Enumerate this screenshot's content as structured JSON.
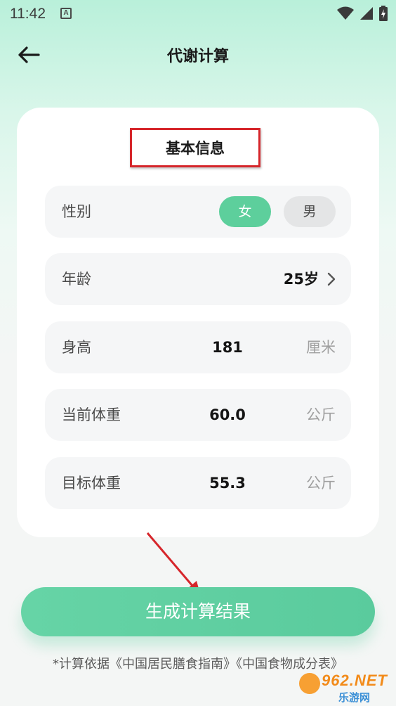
{
  "status_bar": {
    "time": "11:42",
    "app_icon_letter": "A"
  },
  "nav": {
    "title": "代谢计算"
  },
  "card": {
    "section_title": "基本信息",
    "gender": {
      "label": "性别",
      "options": [
        "女",
        "男"
      ],
      "selected": "女"
    },
    "age": {
      "label": "年龄",
      "value": "25岁"
    },
    "height": {
      "label": "身高",
      "value": "181",
      "unit": "厘米"
    },
    "current_weight": {
      "label": "当前体重",
      "value": "60.0",
      "unit": "公斤"
    },
    "target_weight": {
      "label": "目标体重",
      "value": "55.3",
      "unit": "公斤"
    }
  },
  "generate_button": {
    "label": "生成计算结果"
  },
  "footnote": "*计算依据《中国居民膳食指南》《中国食物成分表》",
  "watermark": {
    "top": "962.NET",
    "bottom": "乐游网"
  },
  "colors": {
    "accent": "#5dcf9c",
    "annotation": "#d6262b"
  },
  "icons": [
    "back-arrow-icon",
    "wifi-icon",
    "cellular-icon",
    "battery-icon",
    "chevron-right-icon"
  ]
}
